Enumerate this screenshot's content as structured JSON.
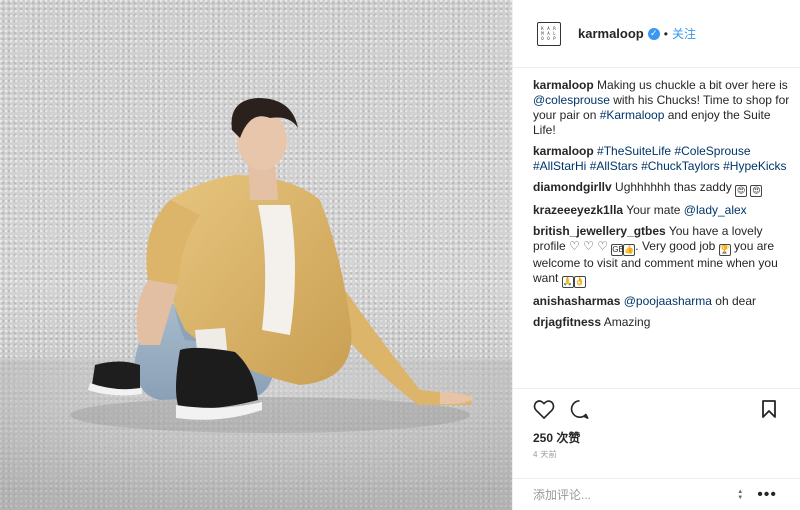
{
  "header": {
    "logo_text": [
      "K",
      "A",
      "R",
      "M",
      "A",
      "L",
      "O",
      "O",
      "P"
    ],
    "username": "karmaloop",
    "verified": "✓",
    "separator": "•",
    "follow_label": "关注"
  },
  "comments": [
    {
      "user": "karmaloop",
      "parts": [
        {
          "t": " Making us chuckle a bit over here is "
        },
        {
          "t": "@colesprouse",
          "link": true
        },
        {
          "t": " with his Chucks! Time to shop for your pair on "
        },
        {
          "t": "#Karmaloop",
          "link": true
        },
        {
          "t": " and enjoy the Suite Life!"
        }
      ]
    },
    {
      "user": "karmaloop",
      "parts": [
        {
          "t": " "
        },
        {
          "t": "#TheSuiteLife",
          "link": true
        },
        {
          "t": " "
        },
        {
          "t": "#ColeSprouse",
          "link": true
        },
        {
          "t": " "
        },
        {
          "t": "#AllStarHi",
          "link": true
        },
        {
          "t": " "
        },
        {
          "t": "#AllStars",
          "link": true
        },
        {
          "t": " "
        },
        {
          "t": "#ChuckTaylors",
          "link": true
        },
        {
          "t": " "
        },
        {
          "t": "#HypeKicks",
          "link": true
        }
      ]
    },
    {
      "user": "diamondgirllv",
      "parts": [
        {
          "t": " Ughhhhhh thas zaddy "
        },
        {
          "emoji": "😍"
        },
        {
          "t": " "
        },
        {
          "emoji": "😍"
        }
      ]
    },
    {
      "user": "krazeeeyezk1lla",
      "parts": [
        {
          "t": " Your mate "
        },
        {
          "t": "@lady_alex",
          "link": true
        }
      ]
    },
    {
      "user": "british_jewellery_gtbes",
      "parts": [
        {
          "t": " You have a lovely profile ♡ ♡ ♡ "
        },
        {
          "emoji": "GB"
        },
        {
          "emoji": "👍"
        },
        {
          "t": ". Very good job "
        },
        {
          "emoji": "🏆"
        },
        {
          "t": " you are welcome to visit and comment mine when you want "
        },
        {
          "emoji": "🙏"
        },
        {
          "emoji": "👌"
        }
      ]
    },
    {
      "user": "anishasharmas",
      "parts": [
        {
          "t": " "
        },
        {
          "t": "@poojaasharma",
          "link": true
        },
        {
          "t": " oh dear"
        }
      ]
    },
    {
      "user": "drjagfitness",
      "parts": [
        {
          "t": " Amazing"
        }
      ]
    }
  ],
  "actions": {
    "like_icon": "heart-icon",
    "comment_icon": "comment-icon",
    "save_icon": "bookmark-icon",
    "likes_text": "250 次赞",
    "time_text": "4 天前"
  },
  "add_comment": {
    "placeholder": "添加评论...",
    "more_icon": "•••"
  }
}
